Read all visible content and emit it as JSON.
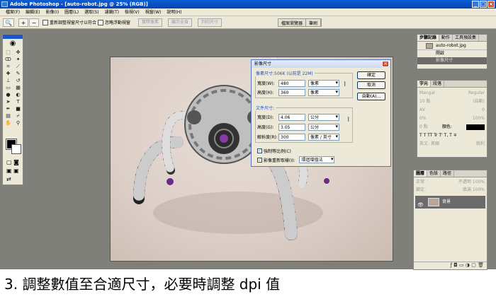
{
  "window": {
    "title": "Adobe Photoshop - [auto-robot.jpg @ 25% (RGB)]",
    "controls": [
      "_",
      "□",
      "×"
    ]
  },
  "menu": [
    "檔案(F)",
    "編輯(E)",
    "影像(I)",
    "圖層(L)",
    "選取(S)",
    "濾鏡(T)",
    "檢視(V)",
    "視窗(W)",
    "說明(H)"
  ],
  "options_bar": {
    "resize_windows": "重新調整視窗尺寸以符合",
    "ignore_palettes": "忽略浮動視窗",
    "actual_pixels": "實際像素",
    "fit_on_screen": "顯示全頁",
    "print_size": "列印尺寸"
  },
  "palette_well": [
    "檔案瀏覽器",
    "筆刷"
  ],
  "image_size_dialog": {
    "title": "影像尺寸",
    "pixel_dimensions_label": "像素尺寸:506K (以前是 22M)",
    "px_width_label": "寬度(W):",
    "px_width_value": "480",
    "px_width_unit": "像素",
    "px_height_label": "高度(H):",
    "px_height_value": "360",
    "px_height_unit": "像素",
    "doc_size_label": "文件尺寸:",
    "doc_width_label": "寬度(D):",
    "doc_width_value": "4.06",
    "doc_width_unit": "公分",
    "doc_height_label": "高度(G):",
    "doc_height_value": "3.05",
    "doc_height_unit": "公分",
    "resolution_label": "解析度(R):",
    "resolution_value": "300",
    "resolution_unit": "像素 / 英寸",
    "constrain_label": "強制等比例(C)",
    "resample_label": "影像重新取樣(I):",
    "resample_method": "環迴增值法",
    "ok_button": "確定",
    "cancel_button": "取消",
    "auto_button": "自動(A)..."
  },
  "history_panel": {
    "tabs": [
      "步驟記錄",
      "動作",
      "工具預設集"
    ],
    "snapshot": "auto-robot.jpg",
    "states": [
      "開啟",
      "影像尺寸"
    ]
  },
  "character_panel": {
    "tabs": [
      "字元",
      "段落"
    ],
    "font": "Mangal",
    "style": "Regular",
    "size": "10 點",
    "leading": "(自動)",
    "tracking": "0",
    "vscale": "0%",
    "hscale": "100%",
    "baseline": "0 點",
    "color_label": "顏色:",
    "language": "英文: 美國",
    "antialias": "銳利"
  },
  "layers_panel": {
    "tabs": [
      "圖層",
      "色版",
      "路徑"
    ],
    "mode": "正常",
    "opacity_label": "不透明",
    "opacity_value": "100%",
    "lock_label": "鎖定:",
    "fill_label": "填滿",
    "fill_value": "100%",
    "layer_name": "背景"
  },
  "caption": "3. 調整數值至合適尺寸，必要時調整 dpi 值"
}
